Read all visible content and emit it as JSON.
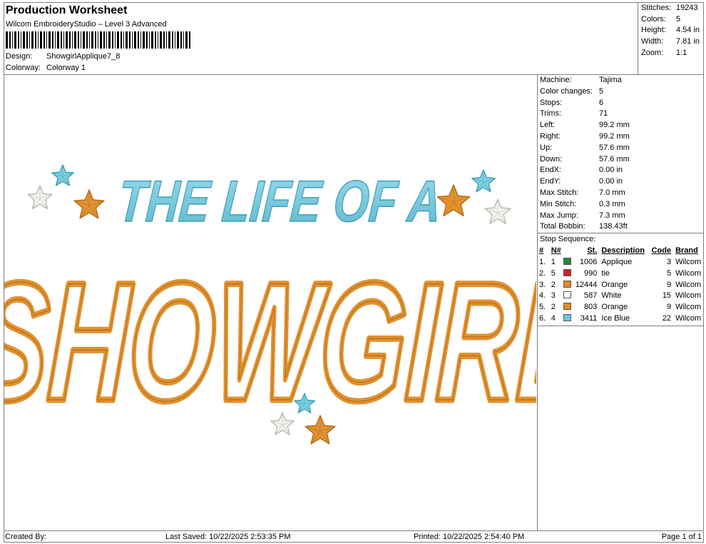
{
  "header": {
    "title": "Production Worksheet",
    "software": "Wilcom EmbroideryStudio – Level 3 Advanced",
    "design_label": "Design:",
    "design_value": "ShowgirlApplique7_8",
    "colorway_label": "Colorway:",
    "colorway_value": "Colorway 1"
  },
  "stats": [
    {
      "label": "Stitches:",
      "value": "19243"
    },
    {
      "label": "Colors:",
      "value": "5"
    },
    {
      "label": "Height:",
      "value": "4.54 in"
    },
    {
      "label": "Width:",
      "value": "7.81 in"
    },
    {
      "label": "Zoom:",
      "value": "1:1"
    }
  ],
  "specs": [
    {
      "label": "Machine:",
      "value": "Tajima"
    },
    {
      "label": "Color changes:",
      "value": "5"
    },
    {
      "label": "Stops:",
      "value": "6"
    },
    {
      "label": "Trims:",
      "value": "71"
    },
    {
      "label": "Left:",
      "value": "99.2 mm"
    },
    {
      "label": "Right:",
      "value": "99.2 mm"
    },
    {
      "label": "Up:",
      "value": "57.6 mm"
    },
    {
      "label": "Down:",
      "value": "57.6 mm"
    },
    {
      "label": "EndX:",
      "value": "0.00 in"
    },
    {
      "label": "EndY:",
      "value": "0.00 in"
    },
    {
      "label": "Max Stitch:",
      "value": "7.0 mm"
    },
    {
      "label": "Min Stitch:",
      "value": "0.3 mm"
    },
    {
      "label": "Max Jump:",
      "value": "7.3 mm"
    },
    {
      "label": "Total Bobbin:",
      "value": "138.43ft"
    }
  ],
  "stop_sequence": {
    "title": "Stop Sequence:",
    "columns": {
      "idx": "#",
      "n": "N#",
      "st": "St.",
      "desc": "Description",
      "code": "Code",
      "brand": "Brand"
    },
    "rows": [
      {
        "idx": "1.",
        "n": "1",
        "color": "#1e8c3a",
        "st": "1006",
        "desc": "Applique",
        "code": "3",
        "brand": "Wilcom"
      },
      {
        "idx": "2.",
        "n": "5",
        "color": "#d42020",
        "st": "990",
        "desc": "tie",
        "code": "5",
        "brand": "Wilcom"
      },
      {
        "idx": "3.",
        "n": "2",
        "color": "#e08a2a",
        "st": "12444",
        "desc": "Orange",
        "code": "9",
        "brand": "Wilcom"
      },
      {
        "idx": "4.",
        "n": "3",
        "color": "#ffffff",
        "st": "587",
        "desc": "White",
        "code": "15",
        "brand": "Wilcom"
      },
      {
        "idx": "5.",
        "n": "2",
        "color": "#e08a2a",
        "st": "803",
        "desc": "Orange",
        "code": "9",
        "brand": "Wilcom"
      },
      {
        "idx": "6.",
        "n": "4",
        "color": "#6cc4dc",
        "st": "3411",
        "desc": "Ice Blue",
        "code": "22",
        "brand": "Wilcom"
      }
    ]
  },
  "design": {
    "line1": "THE LIFE OF A",
    "line2": "SHOWGIRL",
    "colors": {
      "orange": "#e0922e",
      "orange_dark": "#b8681a",
      "ice_blue": "#7ecfe0",
      "ice_blue_dark": "#3e9fb8",
      "white": "#f2f2ee"
    }
  },
  "footer": {
    "created_by": "Created By:",
    "last_saved": "Last Saved: 10/22/2025 2:53:35 PM",
    "printed": "Printed: 10/22/2025 2:54:40 PM",
    "page": "Page 1 of 1"
  }
}
